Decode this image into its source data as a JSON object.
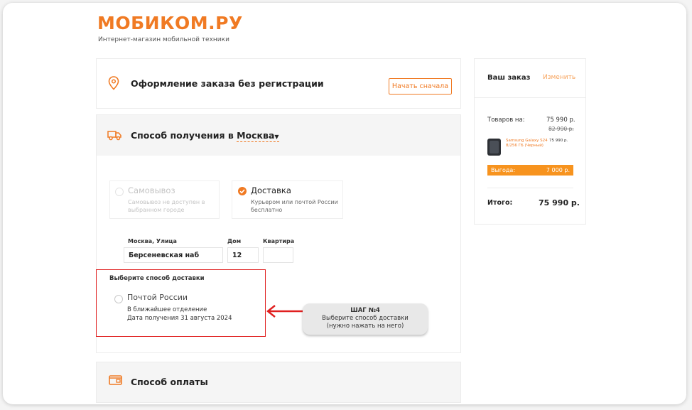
{
  "brand": {
    "logo_text": "МОБИКОМ.РУ",
    "tagline": "Интернет-магазин мобильной техники",
    "accent_color": "#f07a23"
  },
  "checkout_header": {
    "icon": "location-pin-icon",
    "title": "Оформление заказа без регистрации",
    "restart_button": "Начать сначала"
  },
  "receive_section": {
    "icon": "delivery-truck-icon",
    "title_prefix": "Способ получения в ",
    "city": "Москва",
    "dropdown_icon": "caret-down-icon",
    "options": [
      {
        "title": "Самовывоз",
        "subtitle_line1": "Самовывоз не доступен в",
        "subtitle_line2": "выбранном городе",
        "state": "disabled"
      },
      {
        "title": "Доставка",
        "subtitle_line1": "Курьером или почтой России",
        "subtitle_line2": "бесплатно",
        "state": "selected"
      }
    ]
  },
  "address": {
    "street_label": "Москва, Улица",
    "street_value": "Берсеневская наб",
    "house_label": "Дом",
    "house_value": "12",
    "apartment_label": "Квартира",
    "apartment_value": ""
  },
  "delivery_method": {
    "heading": "Выберите способ доставки",
    "option_title": "Почтой России",
    "option_line1": "В ближайшее отделение",
    "option_line2": "Дата получения 31 августа 2024"
  },
  "annotation": {
    "step_title": "ШАГ №4",
    "step_line1": "Выберите способ доставки",
    "step_line2": "(нужно нажать на него)",
    "arrow_color": "#e02020"
  },
  "payment_section": {
    "icon": "wallet-icon",
    "title": "Способ оплаты"
  },
  "order_summary": {
    "title": "Ваш заказ",
    "edit_link": "Изменить",
    "goods_label": "Товаров на:",
    "goods_price": "75 990 р.",
    "old_price": "82 990 р.",
    "item_name_line1": "Samsung Galaxy S24",
    "item_name_line2": "8/256 ГБ (Черный)",
    "item_price": "75 990 р.",
    "saving_label": "Выгода:",
    "saving_value": "7 000 р.",
    "total_label": "Итого:",
    "total_value": "75 990 р."
  }
}
